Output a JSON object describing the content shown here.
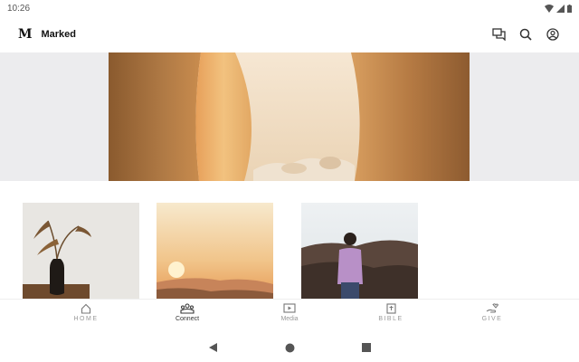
{
  "status_bar": {
    "time": "10:26"
  },
  "app_bar": {
    "logo_letter": "M",
    "title": "Marked"
  },
  "bottom_nav": {
    "items": [
      {
        "label": "HOME",
        "icon": "home-icon",
        "active": false
      },
      {
        "label": "Connect",
        "icon": "people-icon",
        "active": true
      },
      {
        "label": "Media",
        "icon": "play-icon",
        "active": false
      },
      {
        "label": "BIBLE",
        "icon": "book-icon",
        "active": false
      },
      {
        "label": "GIVE",
        "icon": "give-icon",
        "active": false
      }
    ]
  },
  "colors": {
    "hero_bg": "#ececee",
    "nav_inactive": "#999999",
    "nav_active": "#333333"
  }
}
